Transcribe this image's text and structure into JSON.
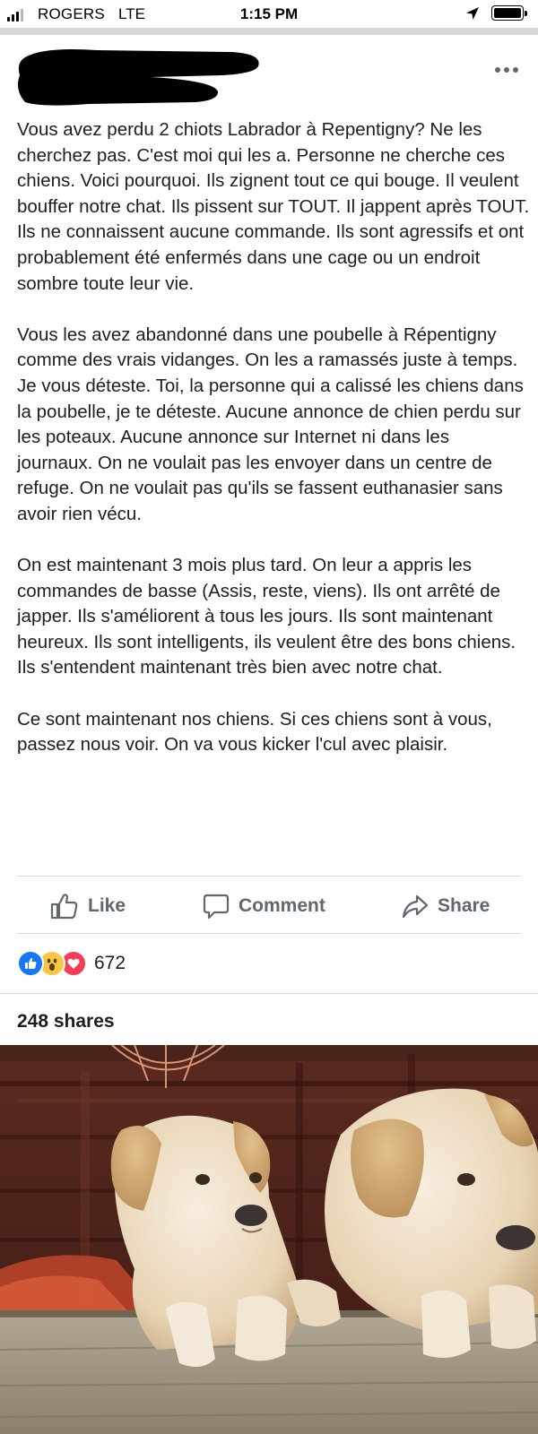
{
  "status_bar": {
    "carrier": "ROGERS",
    "network": "LTE",
    "time": "1:15 PM",
    "signal_bars": 3,
    "signal_max": 4,
    "battery_level": 1.0,
    "icons": [
      "signal-bars-icon",
      "location-arrow-icon",
      "battery-icon"
    ]
  },
  "post": {
    "author_redacted": true,
    "menu_icon": "more-horizontal-icon",
    "paragraphs": [
      "Vous avez perdu 2 chiots Labrador à Repentigny? Ne les cherchez pas. C'est moi qui les a. Personne ne cherche ces chiens. Voici pourquoi. Ils zignent tout ce qui bouge. Il veulent bouffer notre chat. Ils pissent sur TOUT. Il jappent après TOUT. Ils ne connaissent aucune commande. Ils sont agressifs et ont probablement été enfermés dans une cage ou un endroit sombre toute leur vie.",
      "Vous les avez abandonné dans une poubelle à Répentigny comme des vrais vidanges. On les a ramassés juste à temps. Je vous déteste. Toi, la personne qui a calissé les chiens dans la poubelle, je te déteste. Aucune annonce de chien perdu sur les poteaux. Aucune annonce sur Internet ni dans les journaux. On ne voulait pas les envoyer dans un centre de refuge. On ne voulait pas qu'ils se fassent euthanasier sans avoir rien vécu.",
      "On est maintenant 3 mois plus tard. On leur a appris les commandes de basse (Assis, reste, viens). Ils ont arrêté de japper. Ils s'améliorent à tous les jours. Ils sont maintenant heureux. Ils sont intelligents, ils veulent être des bons chiens. Ils s'entendent maintenant très bien avec notre chat.",
      "Ce sont maintenant nos chiens. Si ces chiens sont à vous, passez nous voir. On va vous kicker l'cul avec plaisir."
    ]
  },
  "actions": {
    "like": {
      "label": "Like",
      "icon": "thumbs-up-icon"
    },
    "comment": {
      "label": "Comment",
      "icon": "comment-bubble-icon"
    },
    "share": {
      "label": "Share",
      "icon": "share-arrow-icon"
    }
  },
  "reactions": {
    "types": [
      "like",
      "wow",
      "love"
    ],
    "count": "672"
  },
  "shares_label": "248 shares",
  "colors": {
    "facebook_blue": "#1877f2",
    "action_gray": "#606770",
    "text": "#1c1e21",
    "love_red": "#f33e58",
    "wow_yellow": "#f7c744"
  }
}
